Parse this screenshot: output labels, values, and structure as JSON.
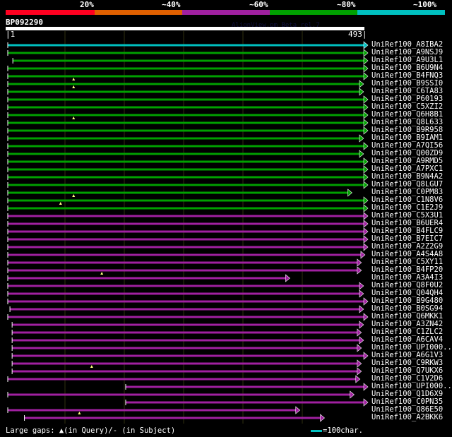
{
  "scale": {
    "labels": [
      "20%",
      "~40%",
      "~60%",
      "~80%",
      "~100%"
    ],
    "colors": [
      "#ff0020",
      "#e06000",
      "#a020a0",
      "#00a000",
      "#00c0c0"
    ]
  },
  "query": {
    "id": "BP092290",
    "start": "|1",
    "end": "493|",
    "length": 493
  },
  "version_text": "AlignView.pm Beta rel.7",
  "hits": [
    {
      "name": "UniRef100_A8IBA2",
      "start": 1,
      "end": 493,
      "color": "#00c0c0",
      "gaps": []
    },
    {
      "name": "UniRef100_A9NSJ9",
      "start": 1,
      "end": 493,
      "color": "#00a000",
      "gaps": []
    },
    {
      "name": "UniRef100_A9U3L1",
      "start": 8,
      "end": 493,
      "color": "#00a000",
      "gaps": []
    },
    {
      "name": "UniRef100_B6U9N4",
      "start": 1,
      "end": 493,
      "color": "#00a000",
      "gaps": []
    },
    {
      "name": "UniRef100_B4FNQ3",
      "start": 1,
      "end": 493,
      "color": "#00a000",
      "gaps": [
        92
      ]
    },
    {
      "name": "UniRef100_B9SSI0",
      "start": 1,
      "end": 487,
      "color": "#00a000",
      "gaps": [
        92
      ]
    },
    {
      "name": "UniRef100_C6TA83",
      "start": 1,
      "end": 487,
      "color": "#00a000",
      "gaps": []
    },
    {
      "name": "UniRef100_P60193",
      "start": 1,
      "end": 493,
      "color": "#00a000",
      "gaps": []
    },
    {
      "name": "UniRef100_C5XZI2",
      "start": 1,
      "end": 493,
      "color": "#00a000",
      "gaps": []
    },
    {
      "name": "UniRef100_Q6H8B1",
      "start": 1,
      "end": 493,
      "color": "#00a000",
      "gaps": [
        92
      ]
    },
    {
      "name": "UniRef100_Q8L633",
      "start": 1,
      "end": 493,
      "color": "#00a000",
      "gaps": []
    },
    {
      "name": "UniRef100_B9R958",
      "start": 1,
      "end": 493,
      "color": "#00a000",
      "gaps": []
    },
    {
      "name": "UniRef100_B9IAM1",
      "start": 1,
      "end": 487,
      "color": "#00a000",
      "gaps": []
    },
    {
      "name": "UniRef100_A7QI56",
      "start": 1,
      "end": 493,
      "color": "#00a000",
      "gaps": []
    },
    {
      "name": "UniRef100_Q00ZD9",
      "start": 1,
      "end": 487,
      "color": "#00a000",
      "gaps": []
    },
    {
      "name": "UniRef100_A9RMD5",
      "start": 1,
      "end": 493,
      "color": "#00a000",
      "gaps": []
    },
    {
      "name": "UniRef100_A7PXC1",
      "start": 1,
      "end": 493,
      "color": "#00a000",
      "gaps": []
    },
    {
      "name": "UniRef100_B9N4A2",
      "start": 1,
      "end": 493,
      "color": "#00a000",
      "gaps": []
    },
    {
      "name": "UniRef100_Q8LGU7",
      "start": 1,
      "end": 493,
      "color": "#00a000",
      "gaps": []
    },
    {
      "name": "UniRef100_C0PM83",
      "start": 1,
      "end": 471,
      "color": "#00a000",
      "gaps": [
        92
      ]
    },
    {
      "name": "UniRef100_C1N8V6",
      "start": 1,
      "end": 493,
      "color": "#00a000",
      "gaps": [
        74
      ]
    },
    {
      "name": "UniRef100_C1E2J9",
      "start": 1,
      "end": 493,
      "color": "#00a000",
      "gaps": []
    },
    {
      "name": "UniRef100_C5X3U1",
      "start": 1,
      "end": 493,
      "color": "#a020a0",
      "gaps": []
    },
    {
      "name": "UniRef100_B6UER4",
      "start": 1,
      "end": 493,
      "color": "#a020a0",
      "gaps": []
    },
    {
      "name": "UniRef100_B4FLC9",
      "start": 1,
      "end": 493,
      "color": "#a020a0",
      "gaps": []
    },
    {
      "name": "UniRef100_B7EIC7",
      "start": 1,
      "end": 493,
      "color": "#a020a0",
      "gaps": []
    },
    {
      "name": "UniRef100_A2Z2G9",
      "start": 1,
      "end": 493,
      "color": "#a020a0",
      "gaps": []
    },
    {
      "name": "UniRef100_A4S4A8",
      "start": 1,
      "end": 489,
      "color": "#a020a0",
      "gaps": []
    },
    {
      "name": "UniRef100_C5XY11",
      "start": 1,
      "end": 484,
      "color": "#a020a0",
      "gaps": []
    },
    {
      "name": "UniRef100_B4FP20",
      "start": 1,
      "end": 484,
      "color": "#a020a0",
      "gaps": [
        131
      ]
    },
    {
      "name": "UniRef100_A3A4I3",
      "start": 1,
      "end": 385,
      "color": "#a020a0",
      "gaps": []
    },
    {
      "name": "UniRef100_Q8F0U2",
      "start": 1,
      "end": 487,
      "color": "#a020a0",
      "gaps": []
    },
    {
      "name": "UniRef100_Q04QH4",
      "start": 1,
      "end": 487,
      "color": "#a020a0",
      "gaps": []
    },
    {
      "name": "UniRef100_B9G480",
      "start": 1,
      "end": 493,
      "color": "#a020a0",
      "gaps": []
    },
    {
      "name": "UniRef100_B0SG94",
      "start": 4,
      "end": 487,
      "color": "#a020a0",
      "gaps": []
    },
    {
      "name": "UniRef100_Q6MKK1",
      "start": 1,
      "end": 493,
      "color": "#a020a0",
      "gaps": []
    },
    {
      "name": "UniRef100_A3ZN42",
      "start": 7,
      "end": 487,
      "color": "#a020a0",
      "gaps": []
    },
    {
      "name": "UniRef100_C1ZLC2",
      "start": 7,
      "end": 484,
      "color": "#a020a0",
      "gaps": []
    },
    {
      "name": "UniRef100_A6CAV4",
      "start": 7,
      "end": 487,
      "color": "#a020a0",
      "gaps": []
    },
    {
      "name": "UniRef100_UPI000..",
      "start": 7,
      "end": 484,
      "color": "#a020a0",
      "gaps": []
    },
    {
      "name": "UniRef100_A6G1V3",
      "start": 7,
      "end": 493,
      "color": "#a020a0",
      "gaps": []
    },
    {
      "name": "UniRef100_C9RKW3",
      "start": 7,
      "end": 484,
      "color": "#a020a0",
      "gaps": [
        117
      ]
    },
    {
      "name": "UniRef100_Q7UKX6",
      "start": 7,
      "end": 484,
      "color": "#a020a0",
      "gaps": []
    },
    {
      "name": "UniRef100_C1V2D6",
      "start": 1,
      "end": 482,
      "color": "#a020a0",
      "gaps": []
    },
    {
      "name": "UniRef100_UPI000..",
      "start": 164,
      "end": 493,
      "color": "#a020a0",
      "gaps": []
    },
    {
      "name": "UniRef100_Q1D6X9",
      "start": 1,
      "end": 474,
      "color": "#a020a0",
      "gaps": []
    },
    {
      "name": "UniRef100_C0PN35",
      "start": 164,
      "end": 493,
      "color": "#a020a0",
      "gaps": []
    },
    {
      "name": "UniRef100_Q86E50",
      "start": 1,
      "end": 399,
      "color": "#a020a0",
      "gaps": [
        100
      ]
    },
    {
      "name": "UniRef100_A2BKK6",
      "start": 24,
      "end": 433,
      "color": "#a020a0",
      "gaps": []
    }
  ],
  "legend": {
    "gaps_text": "Large gaps: ▲(in Query)/- (in Subject)",
    "scale_text": "=100char."
  }
}
